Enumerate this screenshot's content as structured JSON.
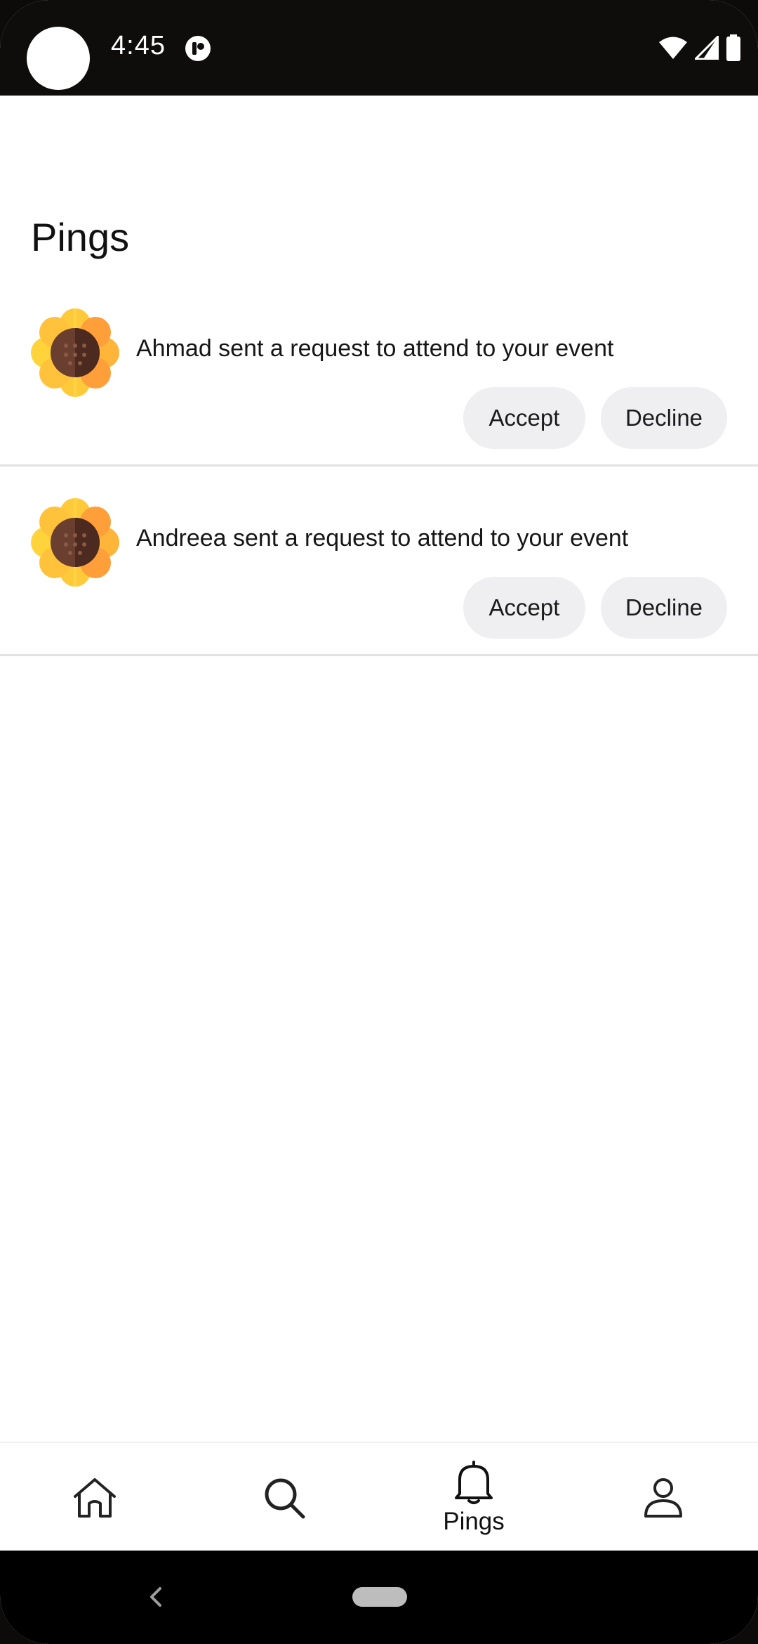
{
  "status_bar": {
    "time": "4:45"
  },
  "page": {
    "title": "Pings"
  },
  "pings": [
    {
      "message": "Ahmad sent a request to attend to your event",
      "accept_label": "Accept",
      "decline_label": "Decline",
      "avatar_icon": "sunflower-icon"
    },
    {
      "message": "Andreea sent a request to attend to your event",
      "accept_label": "Accept",
      "decline_label": "Decline",
      "avatar_icon": "sunflower-icon"
    }
  ],
  "bottom_nav": {
    "items": [
      {
        "icon": "home-icon",
        "label": "",
        "active": false
      },
      {
        "icon": "search-icon",
        "label": "",
        "active": false
      },
      {
        "icon": "bell-icon",
        "label": "Pings",
        "active": true
      },
      {
        "icon": "profile-icon",
        "label": "",
        "active": false
      }
    ]
  },
  "colors": {
    "status_bar_bg": "#0e0d0c",
    "button_bg": "#efeff1",
    "divider": "#e2e2e2",
    "sunflower_petal": "#ffb43a",
    "sunflower_center": "#5a3326"
  }
}
